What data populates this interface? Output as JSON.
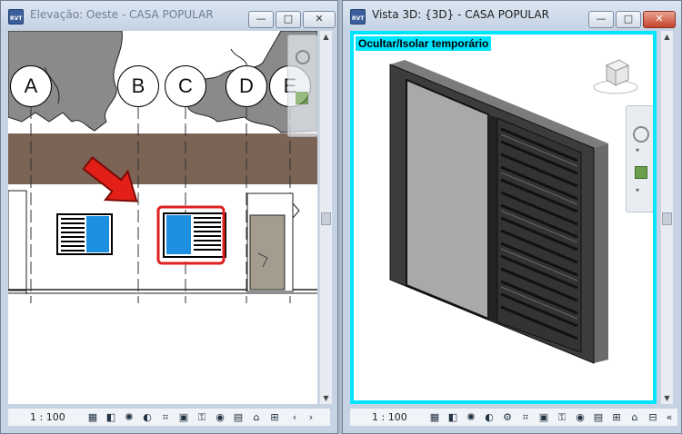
{
  "left_window": {
    "title": "Elevação: Oeste - CASA POPULAR",
    "app_icon_text": "RVT",
    "controls": {
      "minimize": "—",
      "maximize": "□",
      "close": "✕"
    },
    "grid_labels": [
      "A",
      "B",
      "C",
      "D",
      "E"
    ],
    "scale": "1 : 100",
    "highlight_color": "#e02020"
  },
  "right_window": {
    "title": "Vista 3D: {3D} - CASA POPULAR",
    "app_icon_text": "RVT",
    "controls": {
      "minimize": "—",
      "maximize": "□",
      "close": "✕"
    },
    "isolate_label": "Ocultar/Isolar temporário",
    "scale": "1 : 100",
    "border_color": "#00e5ff"
  },
  "icons": {
    "left_status": [
      "detail-level-icon",
      "visual-style-icon",
      "sun-path-icon",
      "shadows-icon",
      "crop-view-icon",
      "show-crop-icon",
      "unlock-3d-icon",
      "temporary-hide-icon",
      "reveal-hidden-icon",
      "render-icon",
      "worksharing-icon",
      "prev-icon",
      "next-icon"
    ],
    "right_status": [
      "detail-level-icon",
      "visual-style-icon",
      "sun-path-icon",
      "shadows-icon",
      "render-icon",
      "crop-view-icon",
      "show-crop-icon",
      "lock-3d-icon",
      "temporary-hide-icon",
      "reveal-hidden-icon",
      "worksharing-icon"
    ]
  }
}
